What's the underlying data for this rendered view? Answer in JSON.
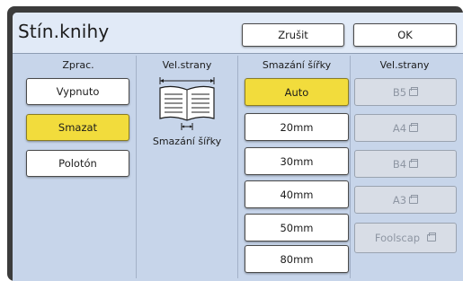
{
  "header": {
    "title": "Stín.knihy",
    "cancel_label": "Zrušit",
    "ok_label": "OK"
  },
  "columns": {
    "processing": {
      "heading": "Zprac.",
      "options": [
        "Vypnuto",
        "Smazat",
        "Polotón"
      ],
      "selected": "Smazat"
    },
    "page_size_illustration": {
      "heading": "Vel.strany",
      "caption": "Smazání šířky"
    },
    "erase_width": {
      "heading": "Smazání šířky",
      "options": [
        "Auto",
        "20mm",
        "30mm",
        "40mm",
        "50mm",
        "80mm"
      ],
      "selected": "Auto"
    },
    "page_size": {
      "heading": "Vel.strany",
      "options": [
        "B5",
        "A4",
        "B4",
        "A3",
        "Foolscap"
      ],
      "disabled": true,
      "icon": "paper-sheet-icon"
    }
  },
  "colors": {
    "selected": "#f2dc3c",
    "panel": "#c7d5ea",
    "header": "#e1eaf7"
  }
}
